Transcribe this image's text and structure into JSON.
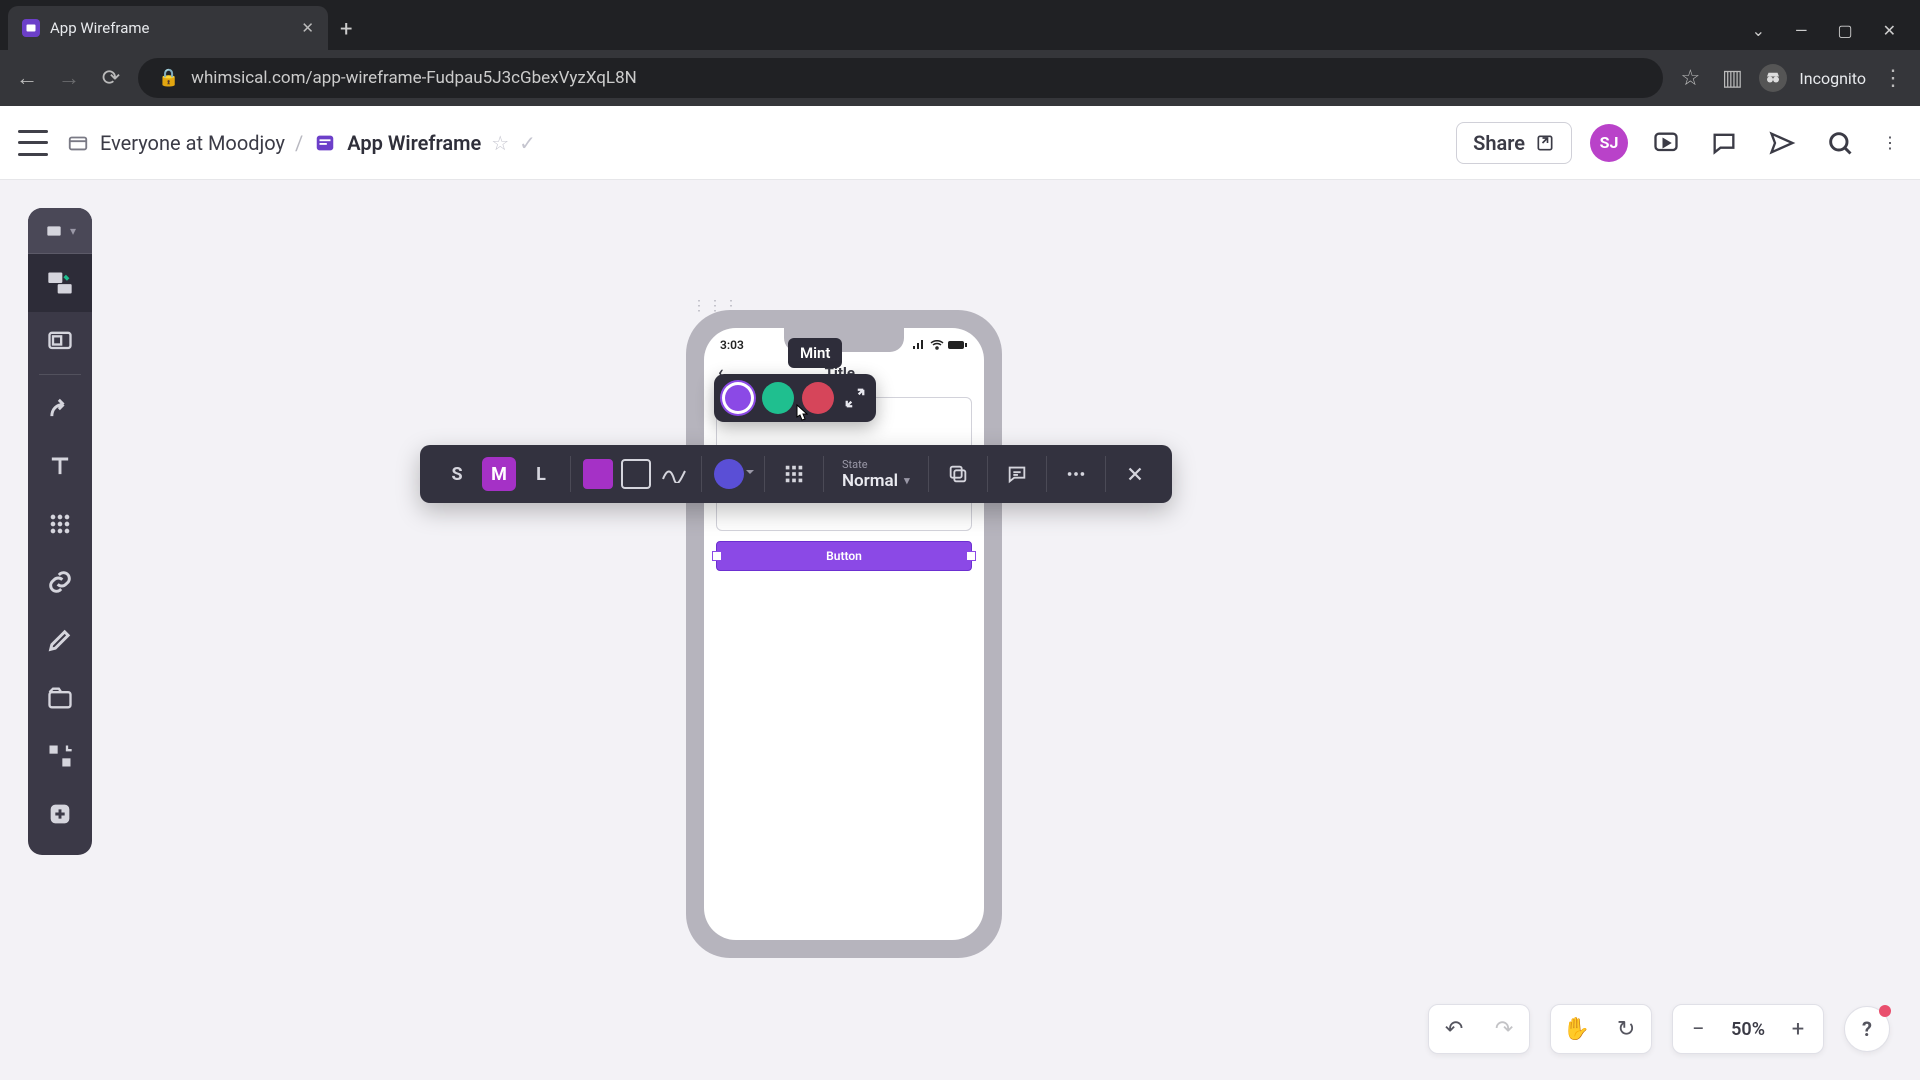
{
  "browser": {
    "tab_title": "App Wireframe",
    "url": "whimsical.com/app-wireframe-Fudpau5J3cGbexVyzXqL8N",
    "incognito_label": "Incognito"
  },
  "header": {
    "workspace": "Everyone at Moodjoy",
    "board": "App Wireframe",
    "share": "Share",
    "user_initials": "SJ"
  },
  "phone": {
    "time": "3:03",
    "nav_title": "Title",
    "button_label": "Button"
  },
  "color_popover": {
    "tooltip": "Mint",
    "colors": {
      "purple": "#8b49e6",
      "mint": "#1fbf8f",
      "red": "#d6455a"
    }
  },
  "context_toolbar": {
    "sizes": {
      "s": "S",
      "m": "M",
      "l": "L"
    },
    "state_label": "State",
    "state_value": "Normal"
  },
  "bottom": {
    "zoom": "50%",
    "help": "?"
  }
}
